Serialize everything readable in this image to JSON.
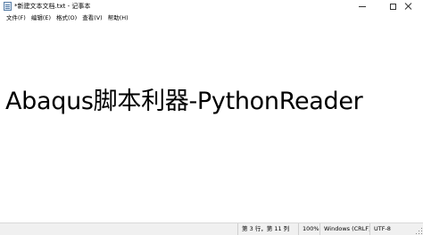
{
  "window": {
    "title": "*新建文本文档.txt - 记事本"
  },
  "menu": {
    "items": [
      {
        "label": "文件(F)"
      },
      {
        "label": "编辑(E)"
      },
      {
        "label": "格式(O)"
      },
      {
        "label": "查看(V)"
      },
      {
        "label": "帮助(H)"
      }
    ]
  },
  "editor": {
    "text": "Abaqus脚本利器-PythonReader"
  },
  "status": {
    "position": "第 3 行，第 11 列",
    "zoom": "100%",
    "line_ending": "Windows (CRLF)",
    "encoding": "UTF-8"
  }
}
